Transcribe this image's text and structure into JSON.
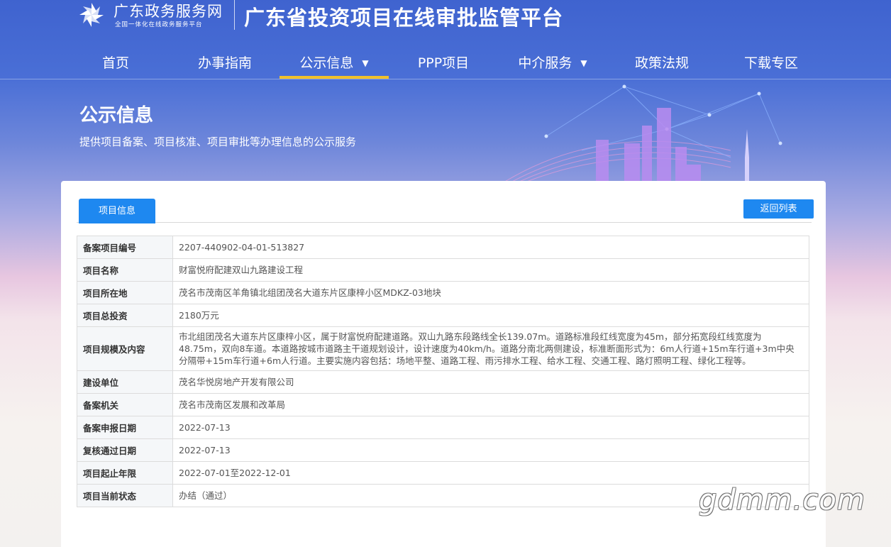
{
  "header": {
    "brand_name": "广东政务服务网",
    "brand_sub": "全国一体化在线政务服务平台",
    "platform_title": "广东省投资项目在线审批监管平台"
  },
  "nav": {
    "items": [
      {
        "label": "首页"
      },
      {
        "label": "办事指南"
      },
      {
        "label": "公示信息",
        "active": true,
        "dropdown": true
      },
      {
        "label": "PPP项目"
      },
      {
        "label": "中介服务",
        "dropdown": true
      },
      {
        "label": "政策法规"
      },
      {
        "label": "下载专区"
      }
    ],
    "caret": "▼"
  },
  "banner": {
    "title": "公示信息",
    "description": "提供项目备案、项目核准、项目审批等办理信息的公示服务"
  },
  "card": {
    "tab_label": "项目信息",
    "back_label": "返回列表"
  },
  "project": {
    "rows": [
      {
        "label": "备案项目编号",
        "value": "2207-440902-04-01-513827"
      },
      {
        "label": "项目名称",
        "value": "财富悦府配建双山九路建设工程"
      },
      {
        "label": "项目所在地",
        "value": "茂名市茂南区羊角镇北组团茂名大道东片区康梓小区MDKZ-03地块"
      },
      {
        "label": "项目总投资",
        "value": "2180万元"
      },
      {
        "label": "项目规模及内容",
        "value": "市北组团茂名大道东片区康梓小区，属于财富悦府配建道路。双山九路东段路线全长139.07m。道路标准段红线宽度为45m，部分拓宽段红线宽度为48.75m，双向8车道。本道路按城市道路主干道规划设计，设计速度为40km/h。道路分南北两侧建设，标准断面形式为：6m人行道+15m车行道+3m中央分隔带+15m车行道+6m人行道。主要实施内容包括：场地平整、道路工程、雨污排水工程、给水工程、交通工程、路灯照明工程、绿化工程等。"
      },
      {
        "label": "建设单位",
        "value": "茂名华悦房地产开发有限公司"
      },
      {
        "label": "备案机关",
        "value": "茂名市茂南区发展和改革局"
      },
      {
        "label": "备案申报日期",
        "value": "2022-07-13"
      },
      {
        "label": "复核通过日期",
        "value": "2022-07-13"
      },
      {
        "label": "项目起止年限",
        "value": "2022-07-01至2022-12-01"
      },
      {
        "label": "项目当前状态",
        "value": "办结（通过）"
      }
    ]
  },
  "watermark": "gdmm.com",
  "colors": {
    "primary_blue": "#1e88f0",
    "nav_active_underline": "#f0c12b",
    "header_blue": "#3f63cf"
  }
}
